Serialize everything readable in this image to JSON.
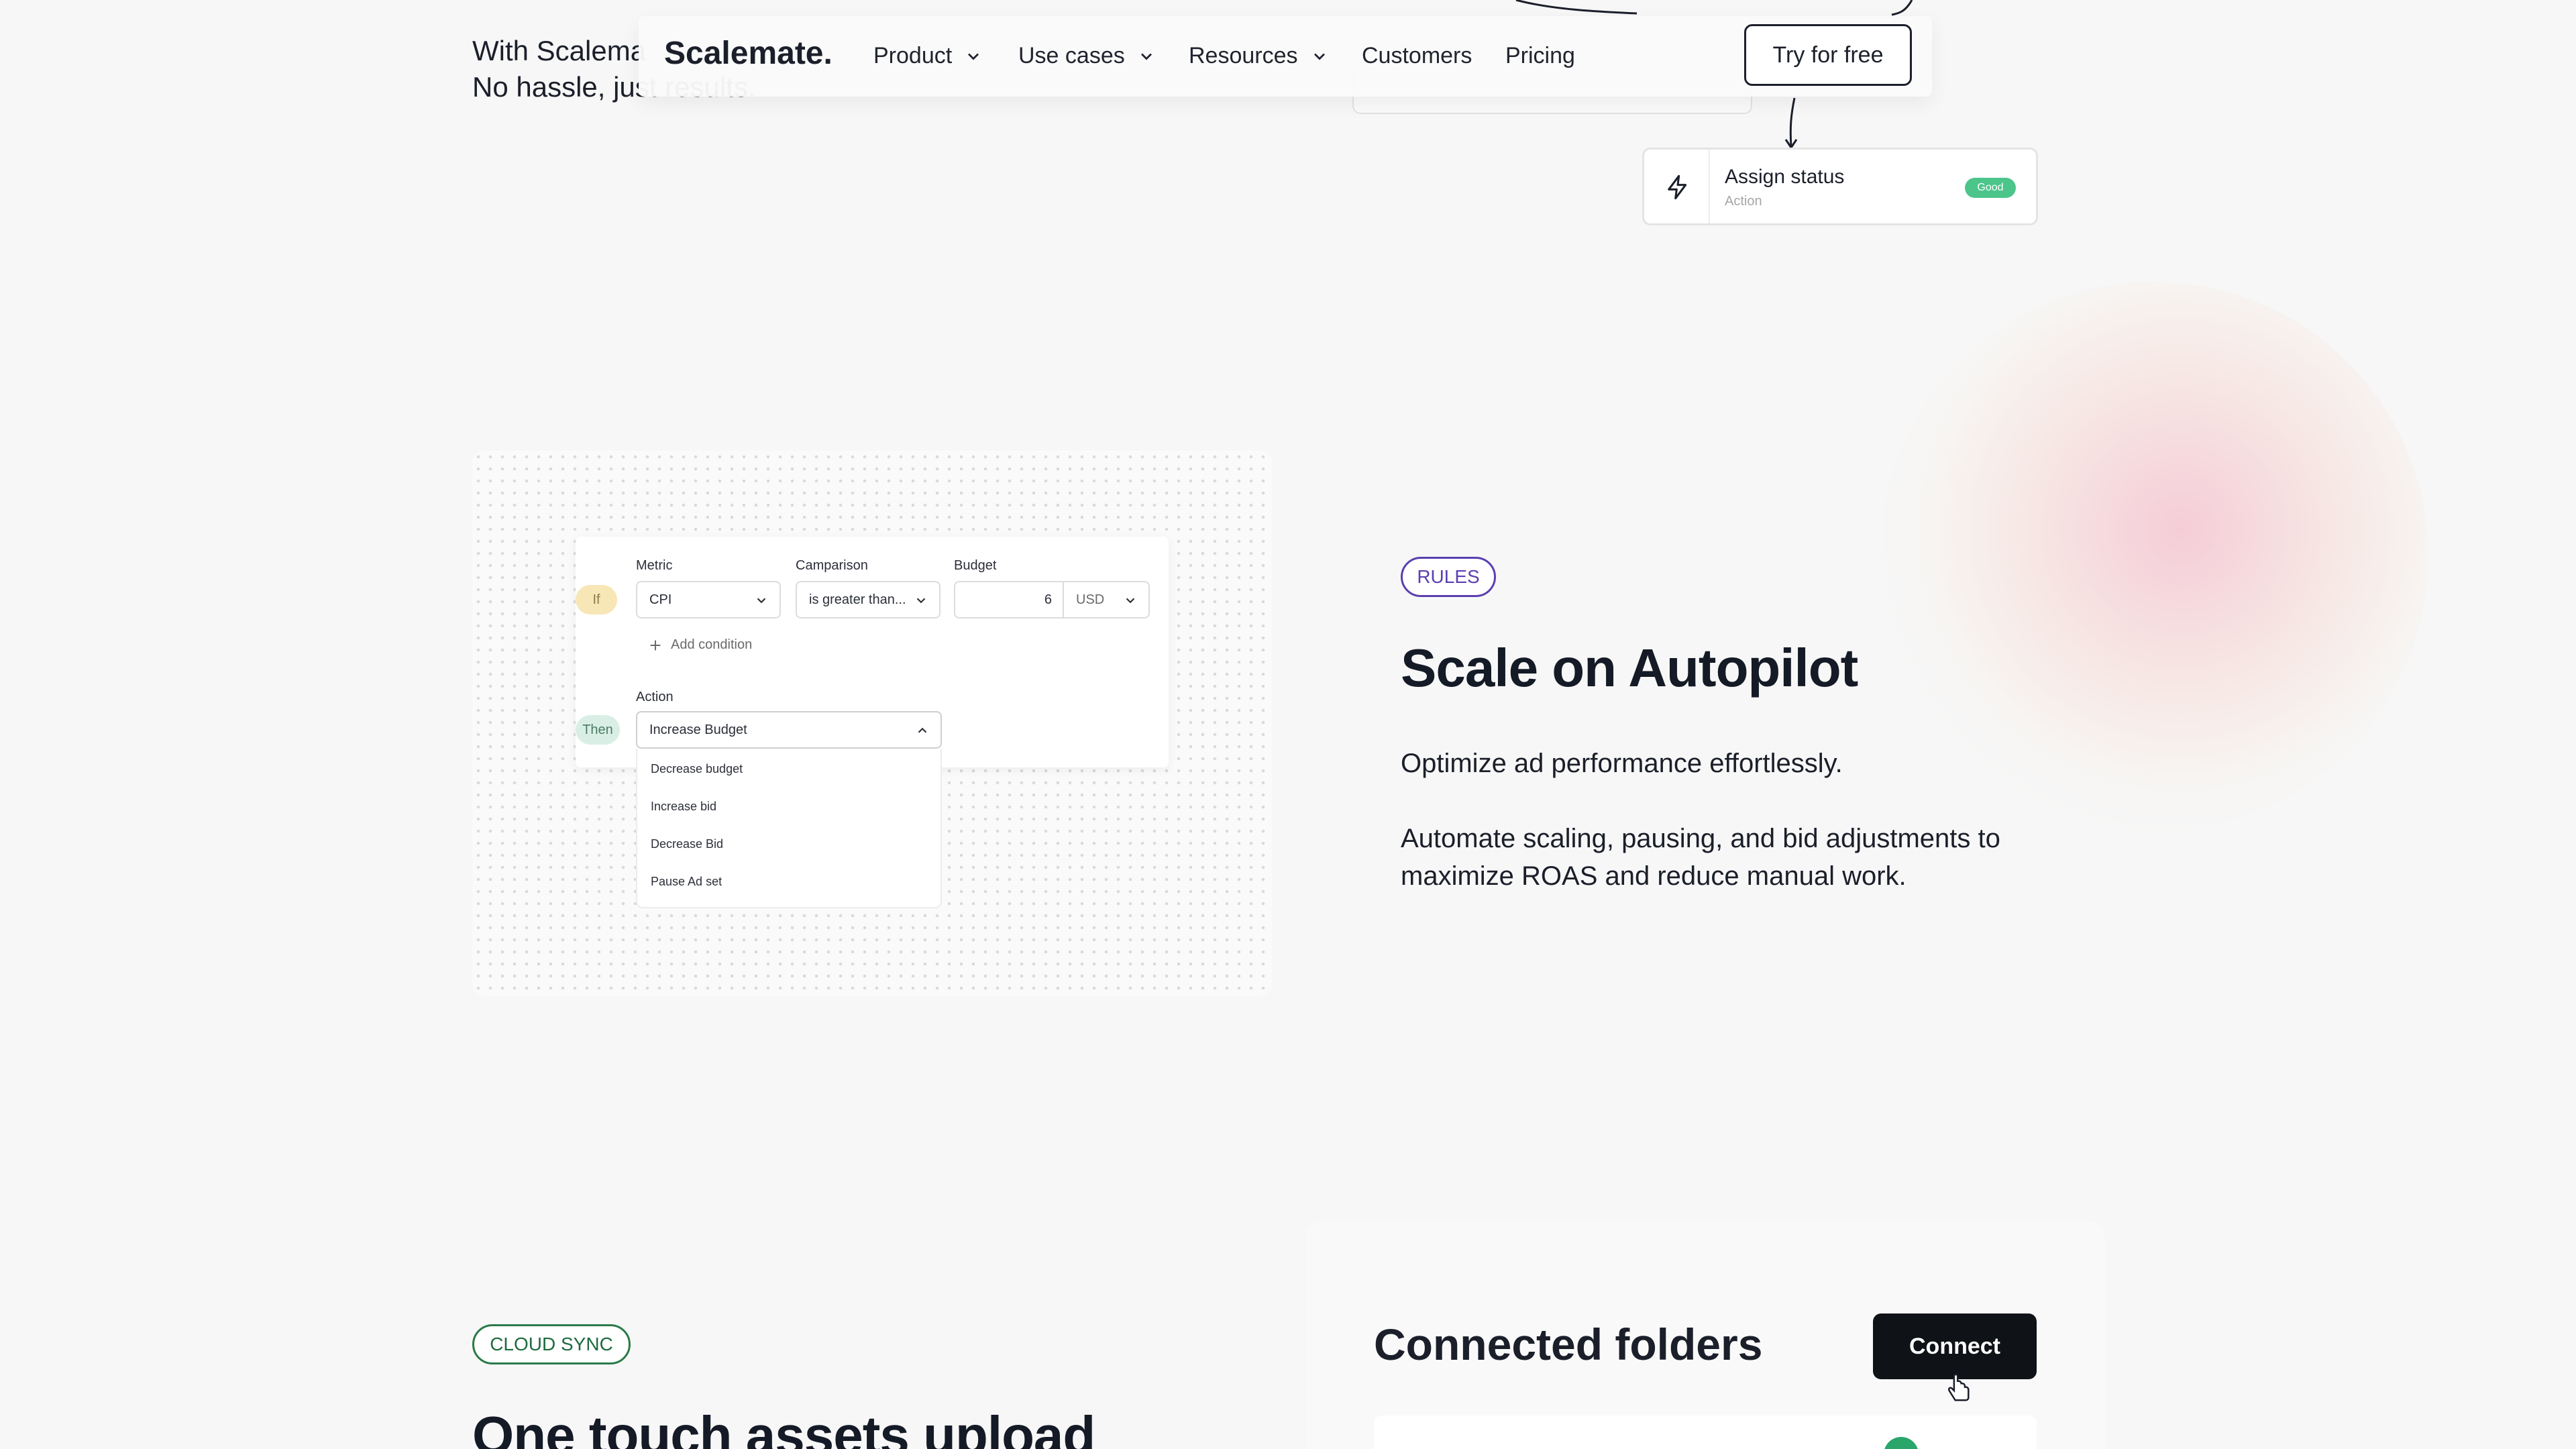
{
  "hero": {
    "line1": "With Scalema",
    "line2": "No hassle, just results."
  },
  "nav": {
    "logo": "Scalemate.",
    "items": [
      {
        "label": "Product",
        "has_dropdown": true
      },
      {
        "label": "Use cases",
        "has_dropdown": true
      },
      {
        "label": "Resources",
        "has_dropdown": true
      },
      {
        "label": "Customers",
        "has_dropdown": false
      },
      {
        "label": "Pricing",
        "has_dropdown": false
      }
    ],
    "cta": "Try for free"
  },
  "workflow": {
    "assign_card": {
      "icon": "lightning-icon",
      "title": "Assign status",
      "subtitle": "Action",
      "badge": "Good",
      "badge_color": "#4cc58a"
    }
  },
  "rules_mockup": {
    "if_label": "If",
    "then_label": "Then",
    "metric": {
      "label": "Metric",
      "value": "CPI"
    },
    "comparison": {
      "label": "Camparison",
      "value": "is greater than..."
    },
    "budget": {
      "label": "Budget",
      "value": "6",
      "currency": "USD"
    },
    "add_condition": "Add condition",
    "action": {
      "label": "Action",
      "value": "Increase Budget"
    },
    "action_options": [
      "Decrease budget",
      "Increase bid",
      "Decrease Bid",
      "Pause Ad set"
    ]
  },
  "rules_section": {
    "tag": "RULES",
    "tag_color": "#5b3fb0",
    "title": "Scale on Autopilot",
    "para1": "Optimize ad performance effortlessly.",
    "para2_line1": "Automate scaling, pausing, and bid adjustments to",
    "para2_line2": "maximize ROAS and reduce manual work."
  },
  "cloud_section": {
    "tag": "CLOUD SYNC",
    "tag_color": "#1e6a3e",
    "title": "One touch assets upload",
    "folders": {
      "title": "Connected folders",
      "connect_button": "Connect"
    }
  }
}
